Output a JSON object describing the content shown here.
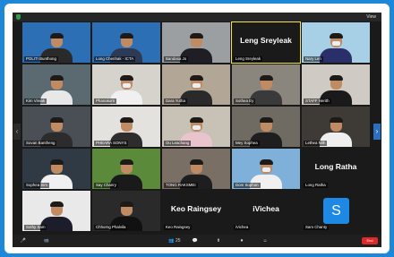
{
  "window": {
    "view_label": "View"
  },
  "participants": [
    {
      "name": "POLITI Bunthong",
      "bg": "#2d6fb5",
      "shirt": "#2a2a2a",
      "row": 0,
      "col": 0,
      "type": "person"
    },
    {
      "name": "Long Chenhak - ICTA",
      "bg": "#2d6fb5",
      "shirt": "#2d3a55",
      "row": 0,
      "col": 1,
      "type": "person"
    },
    {
      "name": "Bandasa Jo",
      "bg": "#9c9fa2",
      "shirt": "#1e1e24",
      "row": 0,
      "col": 2,
      "type": "person"
    },
    {
      "name": "Leng Sreyleak",
      "bg": "#1a1a1a",
      "row": 0,
      "col": 3,
      "type": "namecard",
      "active": true
    },
    {
      "name": "Nary Len",
      "bg": "#a7cfe6",
      "shirt": "#2a2f6a",
      "row": 0,
      "col": 4,
      "type": "person",
      "mask": true
    },
    {
      "name": "Kim Vireak",
      "bg": "#5a6a70",
      "shirt": "#e8e8e8",
      "row": 1,
      "col": 0,
      "type": "person"
    },
    {
      "name": "Phanakorn",
      "bg": "#d6d2cc",
      "shirt": "#f0f0f0",
      "row": 1,
      "col": 1,
      "type": "person",
      "mask": true
    },
    {
      "name": "Dara Yutha",
      "bg": "#b2a696",
      "shirt": "#2a2a2a",
      "row": 1,
      "col": 2,
      "type": "person",
      "mask": true
    },
    {
      "name": "Sothea Ey",
      "bg": "#8a867e",
      "shirt": "#3a3a3a",
      "row": 1,
      "col": 3,
      "type": "person"
    },
    {
      "name": "STAFF Nerith",
      "bg": "#cfcac4",
      "shirt": "#1a1a1a",
      "row": 1,
      "col": 4,
      "type": "person"
    },
    {
      "name": "Sovan Bantheng",
      "bg": "#4a4e55",
      "shirt": "#2c2c2c",
      "row": 2,
      "col": 0,
      "type": "person"
    },
    {
      "name": "PHEARA SONYS",
      "bg": "#e4e2de",
      "shirt": "#2d2d2d",
      "row": 2,
      "col": 1,
      "type": "person"
    },
    {
      "name": "Ou Leachang",
      "bg": "#c7c1b6",
      "shirt": "#e8c4cc",
      "row": 2,
      "col": 2,
      "type": "person",
      "mask": true
    },
    {
      "name": "Mey Sophea",
      "bg": "#6f6a62",
      "shirt": "#1e1e1e",
      "row": 2,
      "col": 3,
      "type": "person"
    },
    {
      "name": "Lethea Nith",
      "bg": "#3e3a35",
      "shirt": "#efefef",
      "row": 2,
      "col": 4,
      "type": "person"
    },
    {
      "name": "Sophea Sim",
      "bg": "#303a44",
      "shirt": "#f0f0f0",
      "row": 3,
      "col": 0,
      "type": "person"
    },
    {
      "name": "Say Chanry",
      "bg": "#5a8a3a",
      "shirt": "#1a1a1a",
      "row": 3,
      "col": 1,
      "type": "person"
    },
    {
      "name": "TONG RAKSMEI",
      "bg": "#7a6f64",
      "shirt": "#1e1e1e",
      "row": 3,
      "col": 2,
      "type": "person"
    },
    {
      "name": "Dom Sophon",
      "bg": "#7fb0d9",
      "shirt": "#f0f0f0",
      "row": 3,
      "col": 3,
      "type": "person",
      "mask": true
    },
    {
      "name": "Long Ratha",
      "bg": "#1a1a1a",
      "row": 3,
      "col": 4,
      "type": "namecard"
    },
    {
      "name": "Sothy Sam",
      "bg": "#e9e9e9",
      "shirt": "#1c1c2a",
      "row": 4,
      "col": 0,
      "type": "person"
    },
    {
      "name": "Chhorng Phalvila",
      "bg": "#2a2a2a",
      "shirt": "#111",
      "row": 4,
      "col": 1,
      "type": "person"
    },
    {
      "name": "Keo Raingsey",
      "bg": "#1a1a1a",
      "row": 4,
      "col": 2,
      "type": "namecard"
    },
    {
      "name": "iVichea",
      "bg": "#1a1a1a",
      "row": 4,
      "col": 3,
      "type": "namecard"
    },
    {
      "name": "Sam Chanty",
      "bg": "#1a1a1a",
      "row": 4,
      "col": 4,
      "type": "letter",
      "letter": "S"
    }
  ],
  "toolbar": {
    "items": [
      {
        "key": "mute",
        "label": "🎤"
      },
      {
        "key": "video",
        "label": "📹"
      },
      {
        "key": "participants",
        "label": "👥 25"
      },
      {
        "key": "chat",
        "label": "💬"
      },
      {
        "key": "share",
        "label": "⬆"
      },
      {
        "key": "record",
        "label": "⏺"
      },
      {
        "key": "reactions",
        "label": "☺"
      }
    ],
    "end_label": "End"
  }
}
